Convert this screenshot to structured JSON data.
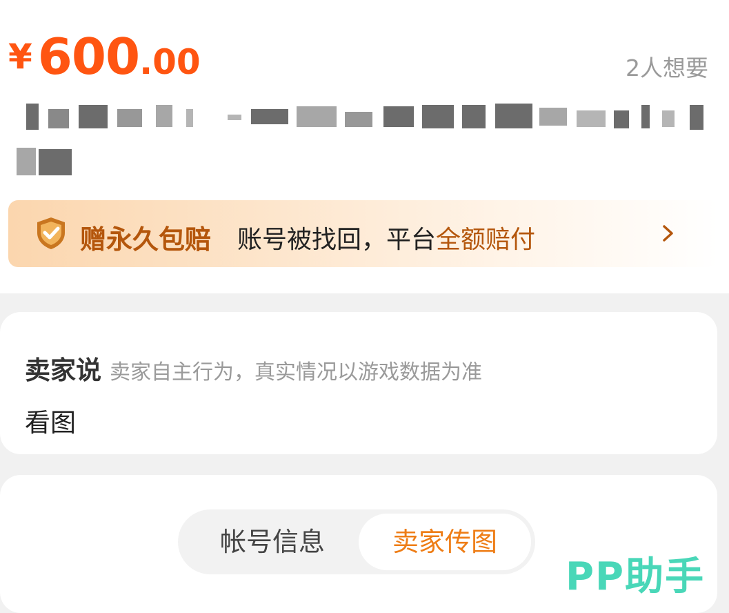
{
  "price": {
    "currency": "¥",
    "integer": "600",
    "decimal": ".00"
  },
  "want_count": "2人想要",
  "guarantee": {
    "title": "赠永久包赔",
    "desc_prefix": "账号被找回，平台",
    "desc_highlight": "全额赔付",
    "icon": "shield-check-icon",
    "arrow_icon": "chevron-right-icon"
  },
  "seller": {
    "title": "卖家说",
    "note": "卖家自主行为，真实情况以游戏数据为准",
    "view_images": "看图"
  },
  "tabs": [
    {
      "label": "帐号信息",
      "active": false
    },
    {
      "label": "卖家传图",
      "active": true
    }
  ],
  "watermark": "PP助手",
  "colors": {
    "price": "#ff5511",
    "accent": "#ee7d16",
    "guarantee_text": "#b4560c",
    "watermark": "#49d7b8"
  }
}
